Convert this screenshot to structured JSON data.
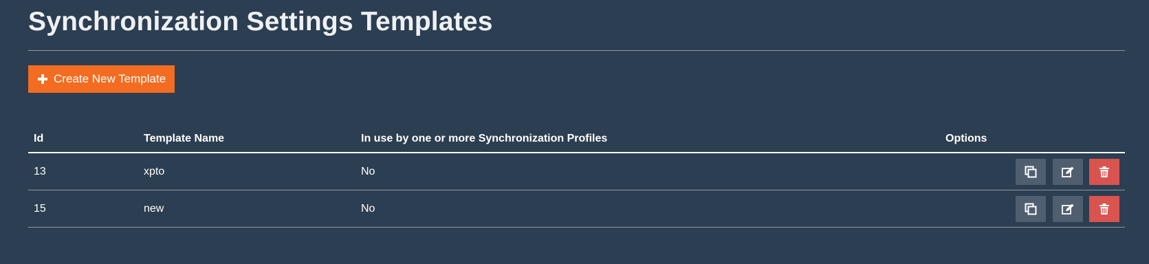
{
  "page": {
    "title": "Synchronization Settings Templates"
  },
  "toolbar": {
    "create_label": "Create New Template",
    "create_icon": "plus-icon",
    "create_color": "#f36c21"
  },
  "table": {
    "columns": [
      "Id",
      "Template Name",
      "In use by one or more Synchronization Profiles",
      "Options"
    ],
    "rows": [
      {
        "id": "13",
        "name": "xpto",
        "in_use": "No"
      },
      {
        "id": "15",
        "name": "new",
        "in_use": "No"
      }
    ],
    "row_actions": [
      {
        "name": "duplicate",
        "icon": "copy-icon",
        "color": "#4f5f70"
      },
      {
        "name": "edit",
        "icon": "edit-icon",
        "color": "#4f5f70"
      },
      {
        "name": "delete",
        "icon": "trash-icon",
        "color": "#d9534f"
      }
    ]
  },
  "colors": {
    "background": "#2c3e51",
    "danger": "#d9534f",
    "accent": "#f36c21"
  }
}
